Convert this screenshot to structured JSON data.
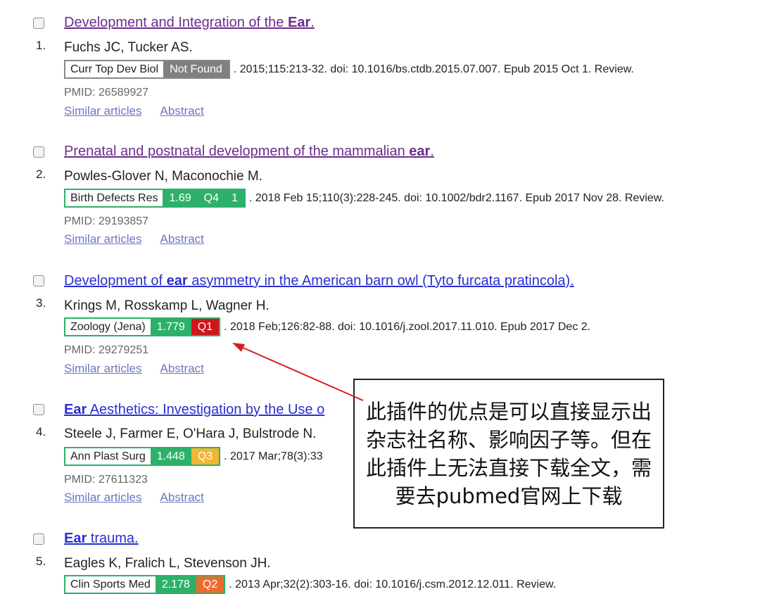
{
  "results": [
    {
      "number": "1.",
      "title_parts": [
        {
          "text": "Development and Integration of the "
        },
        {
          "text": "Ear",
          "bold": true
        },
        {
          "text": "."
        }
      ],
      "authors": "Fuchs JC, Tucker AS.",
      "journal": "Curr Top Dev Biol",
      "badges": [
        {
          "text": "Not Found",
          "color": "#808080"
        }
      ],
      "citation_rest": ". 2015;115:213-32. doi: 10.1016/bs.ctdb.2015.07.007. Epub 2015 Oct 1. Review.",
      "pmid": "PMID: 26589927",
      "similar_label": "Similar articles",
      "abstract_label": "Abstract"
    },
    {
      "number": "2.",
      "title_parts": [
        {
          "text": "Prenatal and postnatal development of the mammalian "
        },
        {
          "text": "ear",
          "bold": true
        },
        {
          "text": "."
        }
      ],
      "authors": "Powles-Glover N, Maconochie M.",
      "journal": "Birth Defects Res",
      "badges": [
        {
          "text": "1.69",
          "color": "#2db16a"
        },
        {
          "text": "Q4",
          "color": "#2db16a"
        },
        {
          "text": "1",
          "color": "#2db16a"
        }
      ],
      "citation_rest": ". 2018 Feb 15;110(3):228-245. doi: 10.1002/bdr2.1167. Epub 2017 Nov 28. Review.",
      "pmid": "PMID: 29193857",
      "similar_label": "Similar articles",
      "abstract_label": "Abstract"
    },
    {
      "number": "3.",
      "title_parts": [
        {
          "text": "Development of "
        },
        {
          "text": "ear",
          "bold": true
        },
        {
          "text": " asymmetry in the American barn owl (Tyto furcata pratincola)."
        }
      ],
      "authors": "Krings M, Rosskamp L, Wagner H.",
      "journal": "Zoology (Jena)",
      "badges": [
        {
          "text": "1.779",
          "color": "#2db16a"
        },
        {
          "text": "Q1",
          "color": "#d0151b"
        }
      ],
      "citation_rest": ". 2018 Feb;126:82-88. doi: 10.1016/j.zool.2017.11.010. Epub 2017 Dec 2.",
      "pmid": "PMID: 29279251",
      "similar_label": "Similar articles",
      "abstract_label": "Abstract"
    },
    {
      "number": "4.",
      "title_parts": [
        {
          "text": "Ear",
          "bold": true
        },
        {
          "text": " Aesthetics: Investigation by the Use o"
        }
      ],
      "authors": "Steele J, Farmer E, O'Hara J, Bulstrode N.",
      "journal": "Ann Plast Surg",
      "badges": [
        {
          "text": "1.448",
          "color": "#2db16a"
        },
        {
          "text": "Q3",
          "color": "#f1b632"
        }
      ],
      "citation_rest": ". 2017 Mar;78(3):33",
      "pmid": "PMID: 27611323",
      "similar_label": "Similar articles",
      "abstract_label": "Abstract"
    },
    {
      "number": "5.",
      "title_parts": [
        {
          "text": "Ear",
          "bold": true
        },
        {
          "text": " trauma."
        }
      ],
      "authors": "Eagles K, Fralich L, Stevenson JH.",
      "journal": "Clin Sports Med",
      "badges": [
        {
          "text": "2.178",
          "color": "#2db16a"
        },
        {
          "text": "Q2",
          "color": "#ec6a2e"
        }
      ],
      "citation_rest": ". 2013 Apr;32(2):303-16. doi: 10.1016/j.csm.2012.12.011. Review.",
      "pmid": "",
      "similar_label": "",
      "abstract_label": ""
    }
  ],
  "callout": {
    "text": "此插件的优点是可以直接显示出杂志社名称、影响因子等。但在此插件上无法直接下载全文，需要去pubmed官网上下载"
  },
  "colors": {
    "visited_link": "#6b2d8e",
    "unvisited_link": "#2a2fd0",
    "action_link": "#6b76c2",
    "annotation_arrow": "#d42020"
  }
}
